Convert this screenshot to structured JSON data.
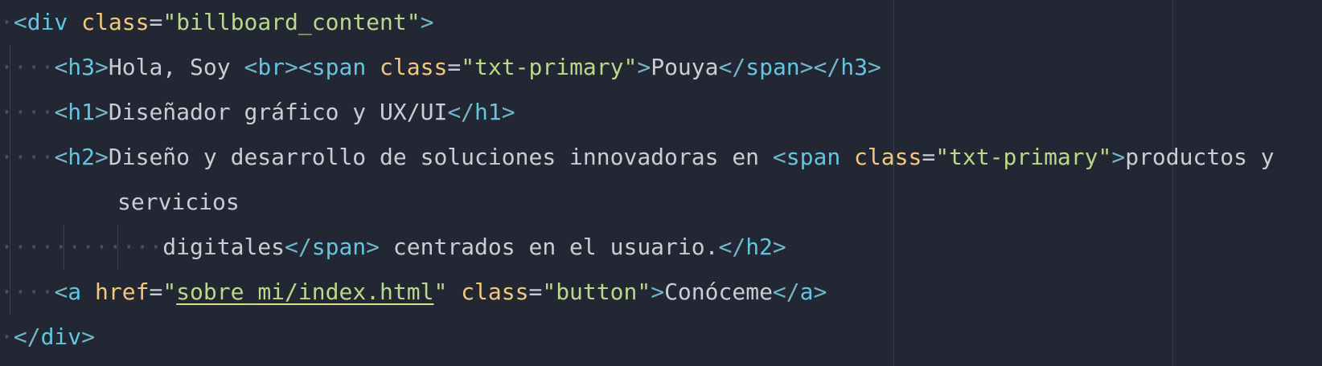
{
  "colors": {
    "background": "#232733",
    "tag": "#62c6e2",
    "attribute": "#f2c97a",
    "string": "#b9d98a",
    "text": "#c9cdd6",
    "whitespace": "#4a5060"
  },
  "code": {
    "line1": {
      "lead": "·",
      "open": "<",
      "tag": "div",
      "sp": " ",
      "attr": "class",
      "eq": "=",
      "val": "\"billboard_content\"",
      "close": ">"
    },
    "line2": {
      "dots": "····",
      "open": "<",
      "tag": "h3",
      "close": ">",
      "text1": "Hola, Soy ",
      "open2": "<",
      "tag2": "br",
      "close2": ">",
      "open3": "<",
      "tag3": "span",
      "sp": " ",
      "attr": "class",
      "eq": "=",
      "val": "\"txt-primary\"",
      "close3": ">",
      "text2": "Pouya",
      "endopen": "</",
      "endtag": "span",
      "endclose": ">",
      "endopen2": "</",
      "endtag2": "h3",
      "endclose2": ">"
    },
    "line3": {
      "dots": "····",
      "open": "<",
      "tag": "h1",
      "close": ">",
      "text": "Diseñador gráfico y UX/UI",
      "endopen": "</",
      "endtag": "h1",
      "endclose": ">"
    },
    "line4": {
      "dots": "····",
      "open": "<",
      "tag": "h2",
      "close": ">",
      "text": "Diseño y desarrollo de soluciones innovadoras en ",
      "open2": "<",
      "tag2": "span",
      "sp": " ",
      "attr": "class",
      "eq": "=",
      "val": "\"txt-primary\"",
      "close2": ">",
      "text2": "productos y"
    },
    "line5": {
      "pad": "        ",
      "text": "servicios"
    },
    "line6": {
      "dots": "············",
      "text": "digitales",
      "endopen": "</",
      "endtag": "span",
      "endclose": ">",
      "text2": " centrados en el usuario.",
      "endopen2": "</",
      "endtag2": "h2",
      "endclose2": ">"
    },
    "line7": {
      "dots": "····",
      "open": "<",
      "tag": "a",
      "sp": " ",
      "attr": "href",
      "eq": "=",
      "q1": "\"",
      "href": "sobre_mi/index.html",
      "q2": "\"",
      "sp2": " ",
      "attr2": "class",
      "eq2": "=",
      "val2": "\"button\"",
      "close": ">",
      "text": "Conóceme",
      "endopen": "</",
      "endtag": "a",
      "endclose": ">"
    },
    "line8": {
      "lead": "·",
      "endopen": "</",
      "endtag": "div",
      "endclose": ">"
    }
  }
}
